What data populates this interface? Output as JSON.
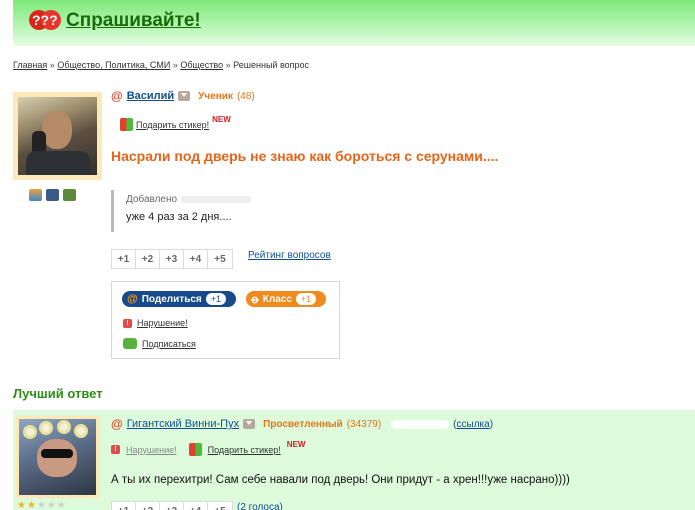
{
  "header": {
    "logo_text": "Спрашивайте!",
    "logo_icon": "question-marks-icon",
    "brand_color": "#186b08"
  },
  "breadcrumb": {
    "items": [
      "Главная",
      "Общество, Политика, СМИ",
      "Общество"
    ],
    "separator": "»",
    "current": "Решенный вопрос"
  },
  "question": {
    "author": {
      "name": "Василий",
      "rank": "Ученик",
      "score": "(48)"
    },
    "gift_label": "Подарить стикер!",
    "new_badge": "NEW",
    "title": "Насрали под дверь не знаю как бороться с серунами....",
    "addendum": {
      "label": "Добавлено",
      "text": "уже 4 раз за 2 дня...."
    },
    "votes": [
      "+1",
      "+2",
      "+3",
      "+4",
      "+5"
    ],
    "rating_link": "Рейтинг вопросов",
    "share": {
      "mail_label": "Поделиться",
      "mail_count": "+1",
      "ok_label": "Класс",
      "ok_count": "+1",
      "report_label": "Нарушение!",
      "subscribe_label": "Подписаться"
    }
  },
  "best_answer": {
    "section_title": "Лучший ответ",
    "author": {
      "name": "Гигантский Винни-Пух",
      "rank": "Просветленный",
      "score": "(34379)"
    },
    "link_label": "ссылка",
    "report_label": "Нарушение!",
    "gift_label": "Подарить стикер!",
    "new_badge": "NEW",
    "text": "А ты их перехитри! Сам себе навали под дверь! Они придут - а хрен!!!уже насрано))))",
    "rating_stars": 2,
    "rating_max": 5,
    "votes": [
      "+1",
      "+2",
      "+3",
      "+4",
      "+5"
    ],
    "votes_count": "(2 голоса)"
  },
  "colors": {
    "accent_orange": "#e4651a",
    "link_blue": "#124e91",
    "best_answer_bg": "#ddfadb"
  }
}
